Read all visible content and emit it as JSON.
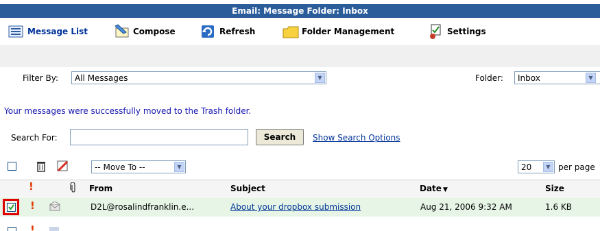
{
  "window": {
    "title": "Email: Message Folder: Inbox"
  },
  "toolbar": {
    "message_list": "Message List",
    "compose": "Compose",
    "refresh": "Refresh",
    "folder_management": "Folder Management",
    "settings": "Settings"
  },
  "filter": {
    "label": "Filter By:",
    "value": "All Messages",
    "folder_label": "Folder:",
    "folder_value": "Inbox"
  },
  "status_message": "Your messages were successfully moved to the Trash folder.",
  "search": {
    "label": "Search For:",
    "value": "",
    "button": "Search",
    "options_link": "Show Search Options"
  },
  "actions": {
    "move_to": "-- Move To --",
    "per_page_value": "20",
    "per_page_label": "per page"
  },
  "columns": {
    "from": "From",
    "subject": "Subject",
    "date": "Date",
    "date_sort": "▼",
    "size": "Size"
  },
  "rows": [
    {
      "checked": true,
      "from": "D2L@rosalindfranklin.e...",
      "subject": "About your dropbox submission",
      "date": "Aug 21, 2006 9:32 AM",
      "size": "1.6 KB"
    }
  ],
  "colors": {
    "title_bar": "#2b5d9b",
    "row_highlight": "#e6f5e6",
    "link": "#003399",
    "priority": "#e23b00"
  }
}
